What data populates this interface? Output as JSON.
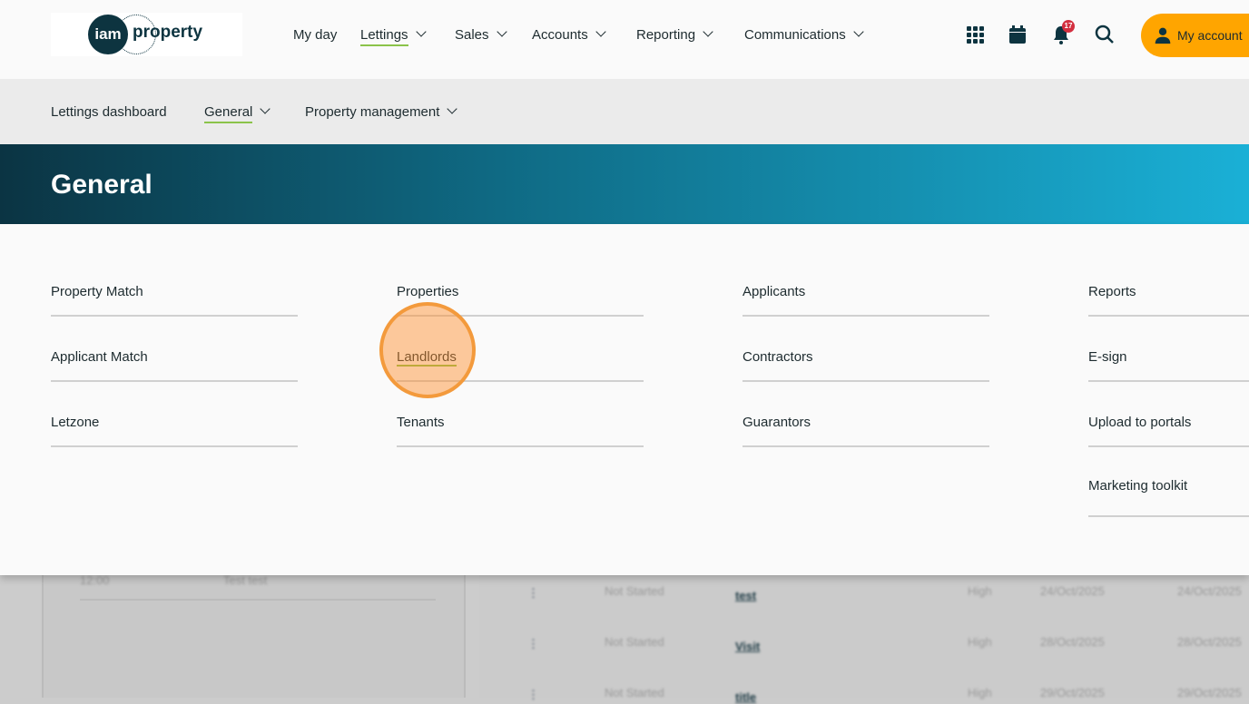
{
  "logo": {
    "text_left": "iam",
    "text_right": "property"
  },
  "top_nav": [
    {
      "label": "My day"
    },
    {
      "label": "Lettings"
    },
    {
      "label": "Sales"
    },
    {
      "label": "Accounts"
    },
    {
      "label": "Reporting"
    },
    {
      "label": "Communications"
    }
  ],
  "notifications_count": "17",
  "account_label": "My account",
  "sub_nav": [
    {
      "label": "Lettings dashboard"
    },
    {
      "label": "General"
    },
    {
      "label": "Property management"
    }
  ],
  "banner_title": "General",
  "menu": {
    "col1": [
      "Property Match",
      "Applicant Match",
      "Letzone"
    ],
    "col2": [
      "Properties",
      "Landlords",
      "Tenants"
    ],
    "col3": [
      "Applicants",
      "Contractors",
      "Guarantors"
    ],
    "col4": [
      "Reports",
      "E-sign",
      "Upload to portals",
      "Marketing toolkit"
    ]
  },
  "background": {
    "left_time": "12:00",
    "left_text": "Test test",
    "rows": [
      {
        "status": "Not Started",
        "title": "test",
        "priority": "High",
        "d1": "24/Oct/2025",
        "d2": "24/Oct/2025"
      },
      {
        "status": "Not Started",
        "title": "Visit",
        "priority": "High",
        "d1": "28/Oct/2025",
        "d2": "28/Oct/2025"
      },
      {
        "status": "Not Started",
        "title": "title",
        "priority": "High",
        "d1": "29/Oct/2025",
        "d2": "29/Oct/2025"
      }
    ]
  }
}
